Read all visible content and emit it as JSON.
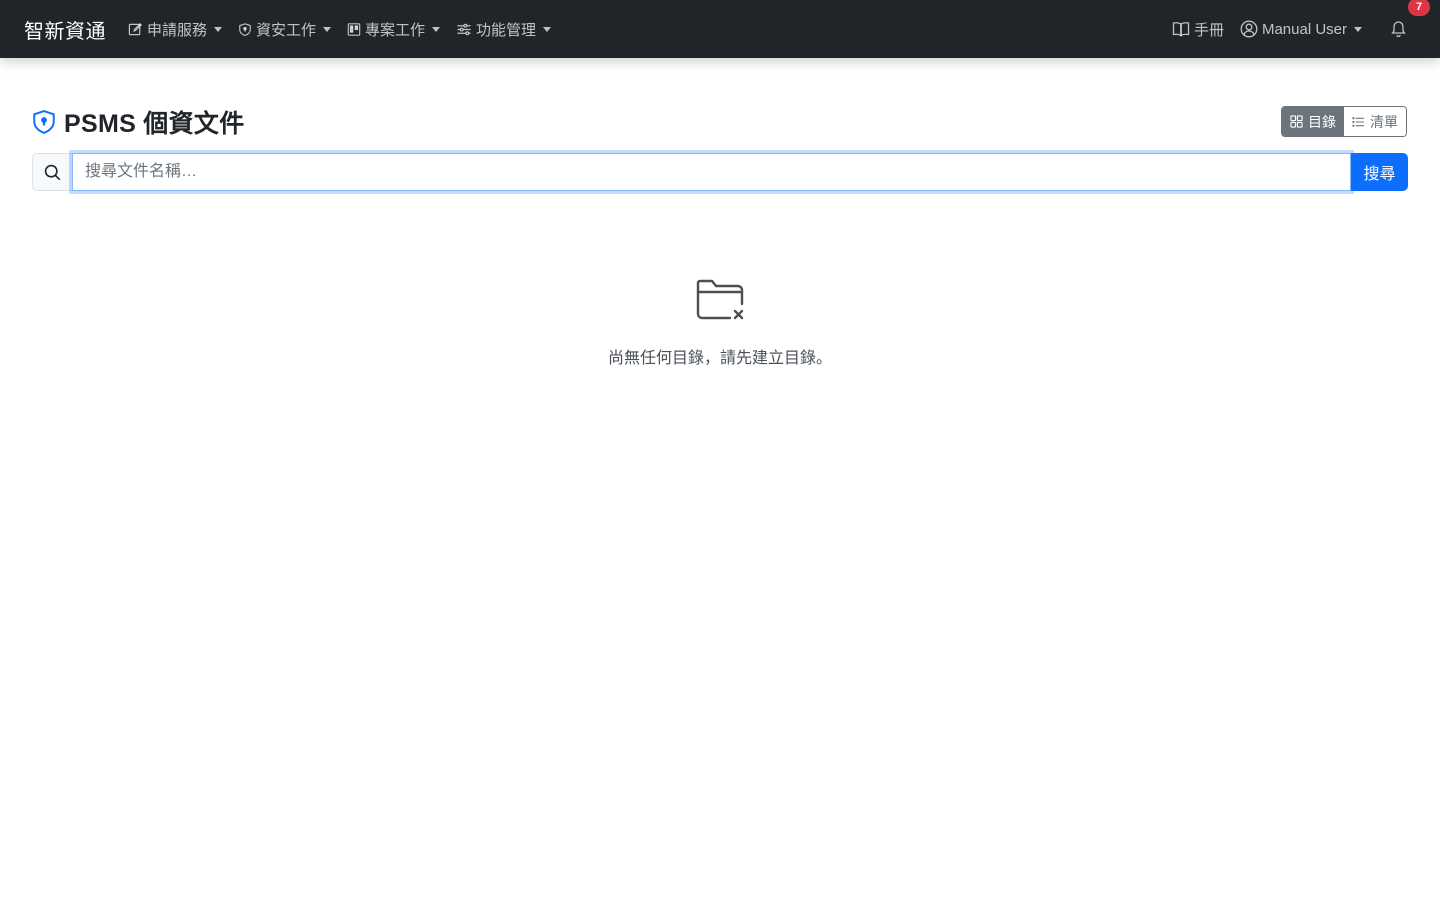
{
  "navbar": {
    "brand": "智新資通",
    "menus": [
      {
        "label": "申請服務",
        "icon": "pencil-square-icon"
      },
      {
        "label": "資安工作",
        "icon": "shield-icon"
      },
      {
        "label": "專案工作",
        "icon": "kanban-icon"
      },
      {
        "label": "功能管理",
        "icon": "sliders-icon"
      }
    ],
    "manual_label": "手冊",
    "user_label": "Manual User",
    "notification_count": "7"
  },
  "page": {
    "title": "PSMS 個資文件",
    "title_icon": "shield-lock-icon",
    "view_toggle": {
      "catalog_label": "目錄",
      "list_label": "清單",
      "active": "catalog"
    }
  },
  "search": {
    "placeholder": "搜尋文件名稱…",
    "value": "",
    "button_label": "搜尋"
  },
  "empty_state": {
    "icon": "folder-x-icon",
    "message": "尚無任何目錄，請先建立目錄。"
  },
  "colors": {
    "navbar_bg": "#212529",
    "primary": "#0d6efd",
    "secondary": "#6c757d",
    "badge": "#dc3545"
  }
}
